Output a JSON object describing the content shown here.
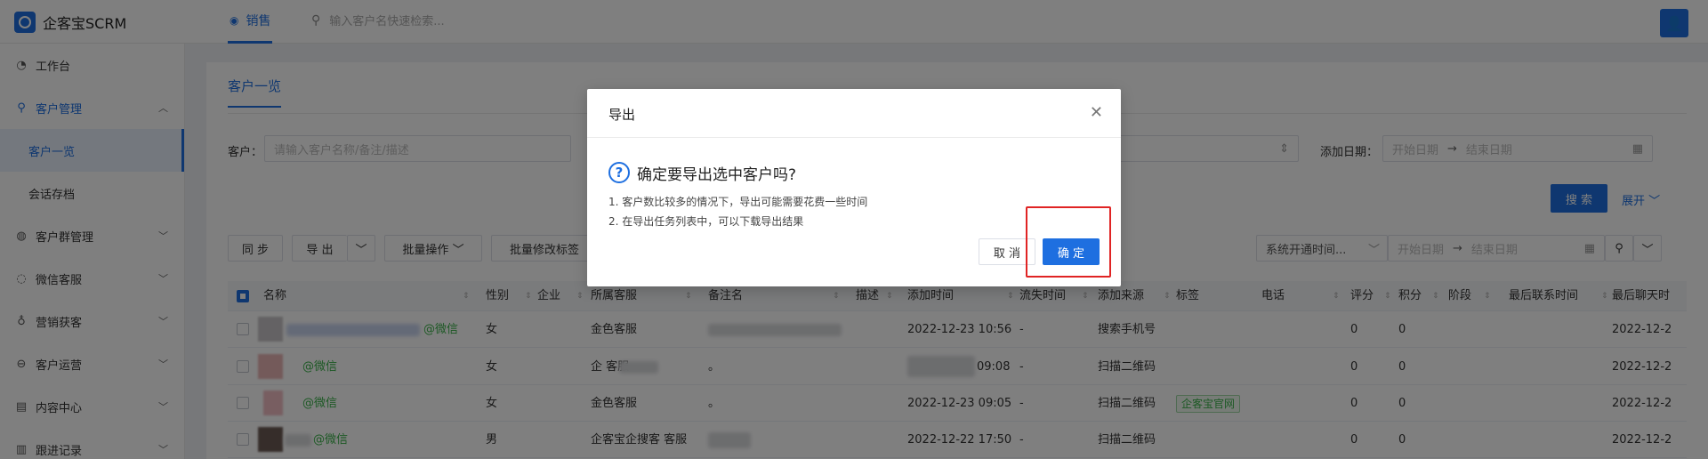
{
  "app": {
    "brand": "企客宝SCRM"
  },
  "topbar": {
    "active_tab": "销售",
    "search_placeholder": "输入客户名快速检索..."
  },
  "sidebar": {
    "items": [
      {
        "label": "工作台",
        "icon": "dashboard-icon"
      },
      {
        "label": "客户管理",
        "icon": "customer-icon",
        "expanded": true,
        "children": [
          {
            "label": "客户一览",
            "active": true
          },
          {
            "label": "会话存档"
          }
        ]
      },
      {
        "label": "客户群管理",
        "icon": "group-icon"
      },
      {
        "label": "微信客服",
        "icon": "service-icon"
      },
      {
        "label": "营销获客",
        "icon": "bulb-icon"
      },
      {
        "label": "客户运营",
        "icon": "operation-icon"
      },
      {
        "label": "内容中心",
        "icon": "content-icon"
      },
      {
        "label": "跟进记录",
        "icon": "record-icon"
      }
    ]
  },
  "panel": {
    "tab": "客户一览",
    "filters": {
      "customer_label": "客户：",
      "customer_placeholder": "请输入客户名称/备注/描述",
      "add_date_label": "添加日期：",
      "start_placeholder": "开始日期",
      "end_placeholder": "结束日期",
      "arrow": "→"
    },
    "search_button": "搜 索",
    "expand_link": "展开",
    "toolbar": {
      "sync": "同 步",
      "export": "导 出",
      "batch_ops": "批量操作",
      "batch_tags": "批量修改标签",
      "time_select": "系统开通时间...",
      "start_placeholder": "开始日期",
      "end_placeholder": "结束日期"
    },
    "table": {
      "columns": [
        "名称",
        "性别",
        "企业",
        "所属客服",
        "备注名",
        "描述",
        "添加时间",
        "流失时间",
        "添加来源",
        "标签",
        "电话",
        "评分",
        "积分",
        "阶段",
        "最后联系时间",
        "最后聊天时"
      ],
      "rows": [
        {
          "name_suffix": "@微信",
          "gender": "女",
          "agent": "金色客服",
          "added": "2022-12-23 10:56",
          "lost": "-",
          "source": "搜索手机号",
          "tag": "",
          "score": "0",
          "points": "0",
          "last_chat": "2022-12-2"
        },
        {
          "name_suffix": "@微信",
          "gender": "女",
          "agent": "企 客服",
          "remark": "。",
          "added": "09:08",
          "lost": "-",
          "source": "扫描二维码",
          "tag": "",
          "score": "0",
          "points": "0",
          "last_chat": "2022-12-2"
        },
        {
          "name_suffix": "@微信",
          "gender": "女",
          "agent": "金色客服",
          "remark": "。",
          "added": "2022-12-23 09:05",
          "lost": "-",
          "source": "扫描二维码",
          "tag": "企客宝官网",
          "score": "0",
          "points": "0",
          "last_chat": "2022-12-2"
        },
        {
          "name_suffix": "@微信",
          "gender": "男",
          "agent": "企客宝企搜客 客服",
          "added": "2022-12-22 17:50",
          "lost": "-",
          "source": "扫描二维码",
          "tag": "",
          "score": "0",
          "points": "0",
          "last_chat": "2022-12-2"
        }
      ]
    }
  },
  "dialog": {
    "title": "导出",
    "heading": "确定要导出选中客户吗?",
    "lines": [
      "1. 客户数比较多的情况下，导出可能需要花费一些时间",
      "2. 在导出任务列表中，可以下载导出结果"
    ],
    "cancel": "取 消",
    "confirm": "确 定"
  },
  "colors": {
    "primary": "#1e6fe0",
    "highlight": "#e02424",
    "wechat": "#3bb24a"
  }
}
